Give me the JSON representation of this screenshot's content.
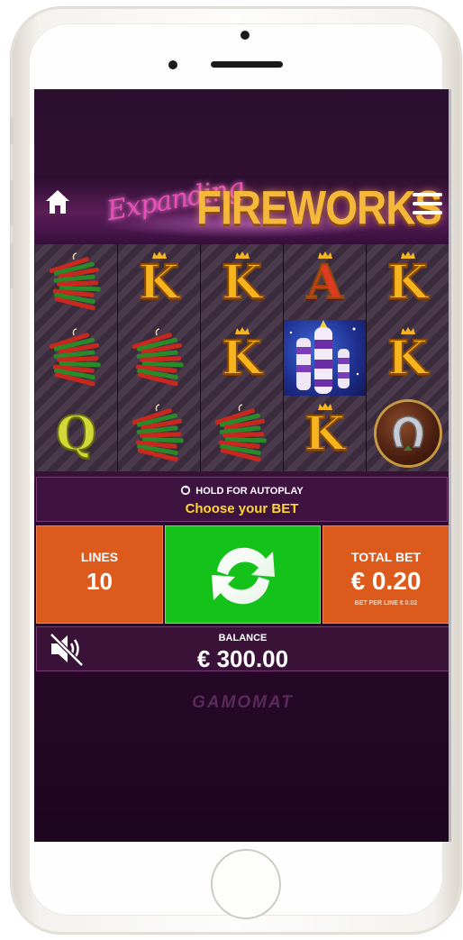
{
  "game": {
    "logo_script": "Expanding",
    "logo_main": "FIREWORKS",
    "brand": "GAMOMAT"
  },
  "reels": {
    "columns": [
      [
        "firecracker",
        "firecracker",
        "Q"
      ],
      [
        "K",
        "firecracker",
        "firecracker"
      ],
      [
        "K",
        "K",
        "firecracker"
      ],
      [
        "A",
        "rocket",
        "K"
      ],
      [
        "K",
        "K",
        "horseshoe"
      ]
    ]
  },
  "panel": {
    "autoplay_hint": "HOLD FOR AUTOPLAY",
    "choose_bet": "Choose your BET",
    "lines_label": "LINES",
    "lines_value": "10",
    "total_bet_label": "TOTAL BET",
    "total_bet_value": "€ 0.20",
    "bet_per_line": "BET PER LINE € 0.02",
    "balance_label": "BALANCE",
    "balance_value": "€ 300.00"
  },
  "icons": {
    "home": "home-icon",
    "menu": "hamburger-menu-icon",
    "spin": "spin-arrows-icon",
    "mute": "speaker-muted-icon"
  },
  "colors": {
    "spin_button": "#14c21a",
    "bet_box": "#dd5a1d",
    "choose_bet_text": "#ffd630",
    "logo_gold": "#f5b83a",
    "logo_pink": "#e64fb8"
  }
}
